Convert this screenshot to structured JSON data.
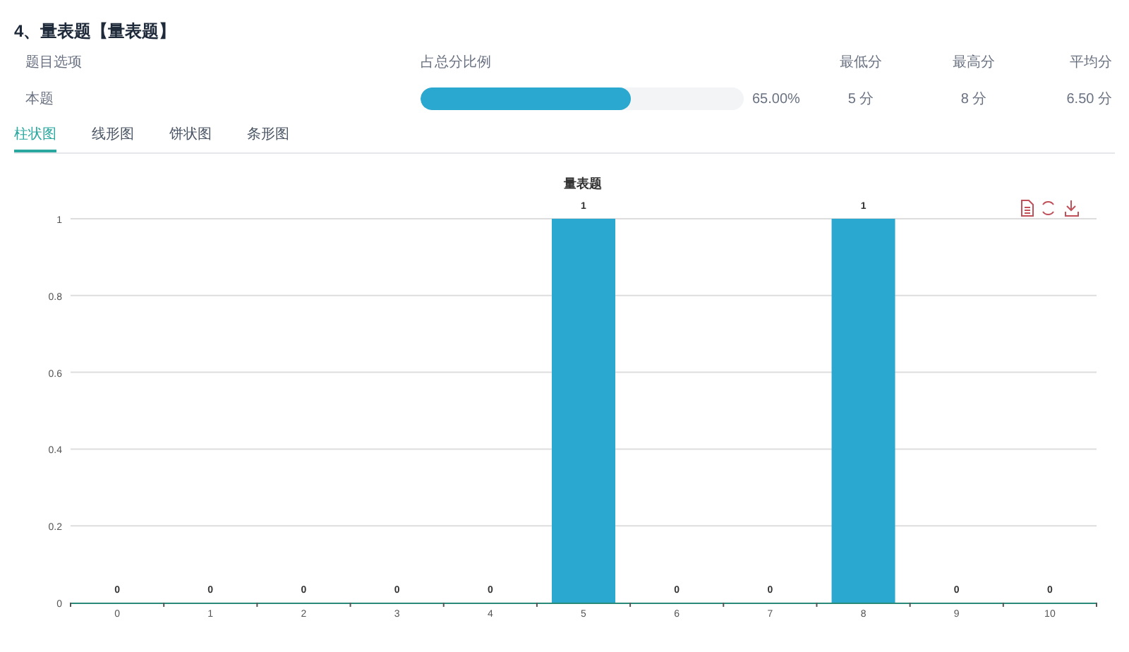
{
  "question_title": "4、量表题【量表题】",
  "table": {
    "columns": [
      "题目选项",
      "占总分比例",
      "最低分",
      "最高分",
      "平均分"
    ],
    "rows": [
      {
        "option": "本题",
        "level": 0.65,
        "ratio": "65.00%",
        "min": "5 分",
        "max": "8 分",
        "avg": "6.50 分"
      }
    ]
  },
  "tabs": [
    {
      "label": "柱状图",
      "selected": true
    },
    {
      "label": "线形图",
      "selected": false
    },
    {
      "label": "饼状图",
      "selected": false
    },
    {
      "label": "条形图",
      "selected": false
    }
  ],
  "chart_data": {
    "type": "bar",
    "title": "量表题",
    "categories": [
      "0",
      "1",
      "2",
      "3",
      "4",
      "5",
      "6",
      "7",
      "8",
      "9",
      "10"
    ],
    "series": [
      {
        "color": "#2aa8d0",
        "values": [
          0,
          0,
          0,
          0,
          0,
          1,
          0,
          0,
          1,
          0,
          0
        ]
      }
    ],
    "grid": true,
    "ylim": [
      0,
      1
    ],
    "yticks": [
      0,
      0.2,
      0.4,
      0.6,
      0.8,
      1
    ],
    "data_labels": true
  }
}
